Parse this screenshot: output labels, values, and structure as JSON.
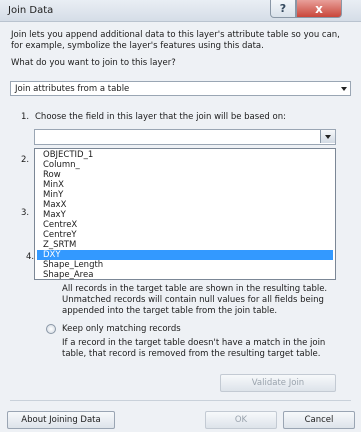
{
  "window": {
    "title": "Join Data",
    "help_label": "?",
    "close_label": "x"
  },
  "intro": "Join lets you append additional data to this layer's attribute table so you can, for example, symbolize the layer's features using this data.",
  "question": "What do you want to join to this layer?",
  "join_type": {
    "selected": "Join attributes from a table"
  },
  "step1": {
    "number": "1.",
    "label": "Choose the field in this layer that the join will be based on:",
    "selected": ""
  },
  "field_list": [
    "OBJECTID_1",
    "Column_",
    "Row",
    "MinX",
    "MinY",
    "MaxX",
    "MaxY",
    "CentreX",
    "CentreY",
    "Z_SRTM",
    "DXY",
    "Shape_Length",
    "Shape_Area"
  ],
  "field_list_selected_index": 10,
  "hidden_numbers": [
    "2.",
    "3.",
    "4."
  ],
  "option_all": {
    "description": "All records in the target table are shown in the resulting table. Unmatched records will contain null values for all fields being appended into the target table from the join table."
  },
  "option_matching": {
    "label": "Keep only matching records",
    "description": "If a record in the target table doesn't have a match in the join table, that record is removed from the resulting target table."
  },
  "buttons": {
    "validate": "Validate Join",
    "about": "About Joining Data",
    "ok": "OK",
    "cancel": "Cancel"
  }
}
